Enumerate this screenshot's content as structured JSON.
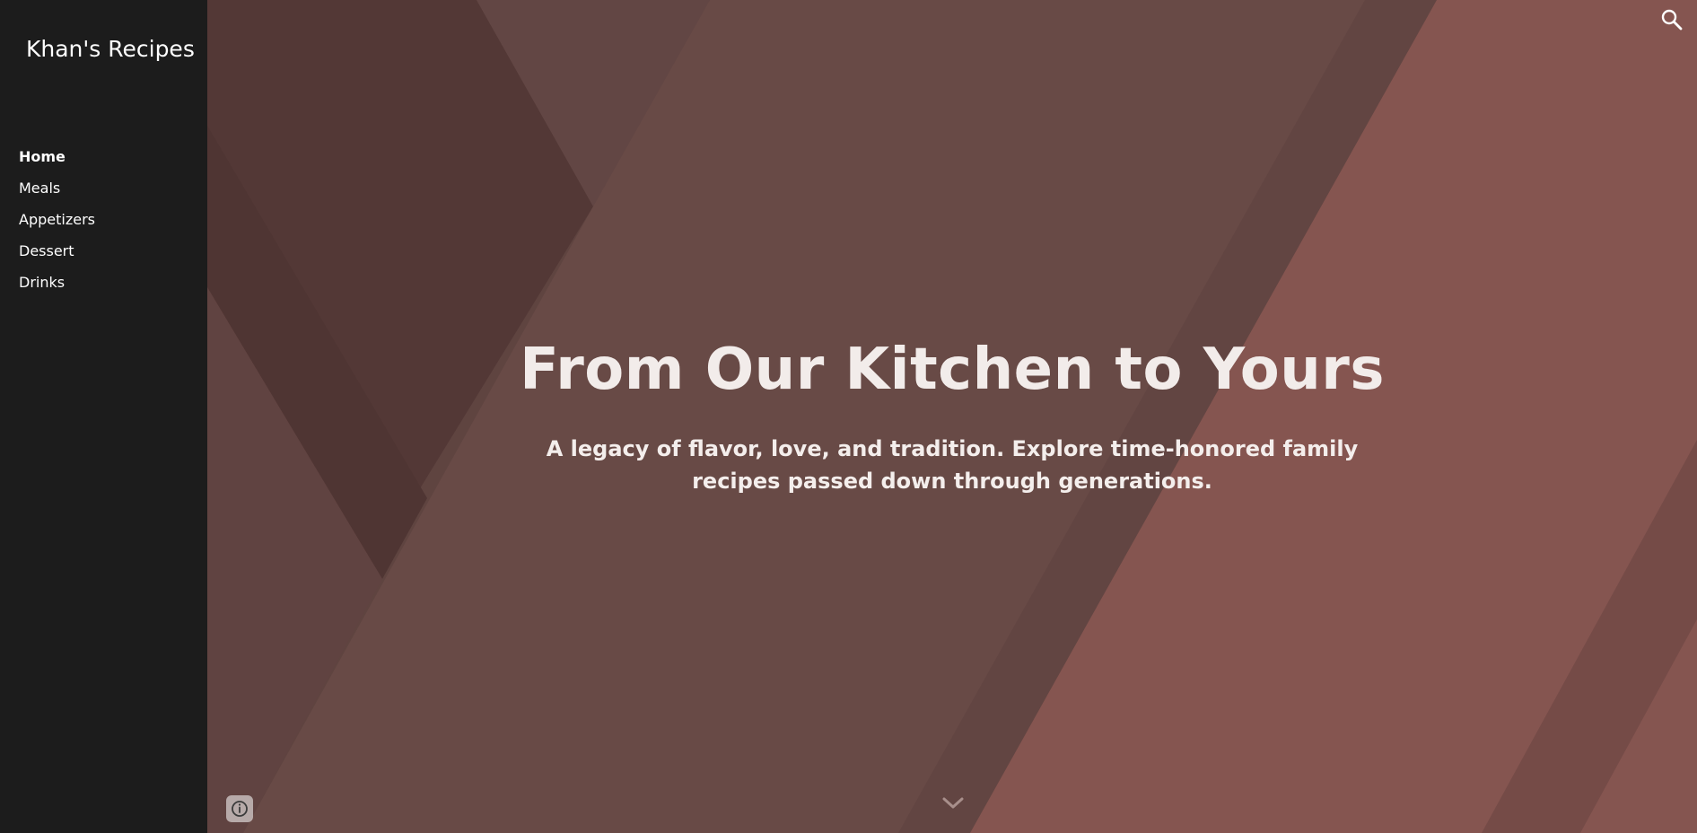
{
  "site": {
    "title": "Khan's Recipes"
  },
  "nav": {
    "items": [
      {
        "label": "Home",
        "active": true
      },
      {
        "label": "Meals",
        "active": false
      },
      {
        "label": "Appetizers",
        "active": false
      },
      {
        "label": "Dessert",
        "active": false
      },
      {
        "label": "Drinks",
        "active": false
      }
    ]
  },
  "hero": {
    "title": "From Our Kitchen to Yours",
    "subtitle": "A legacy of flavor, love, and tradition. Explore time-honored family recipes passed down through generations."
  },
  "icons": {
    "search": "search-icon",
    "scroll": "chevron-down-icon",
    "info": "info-icon"
  },
  "colors": {
    "sidebar_bg": "#1c1c1c",
    "hero_base": "#664843",
    "hero_accent": "#87554f",
    "text": "#ffffff"
  }
}
